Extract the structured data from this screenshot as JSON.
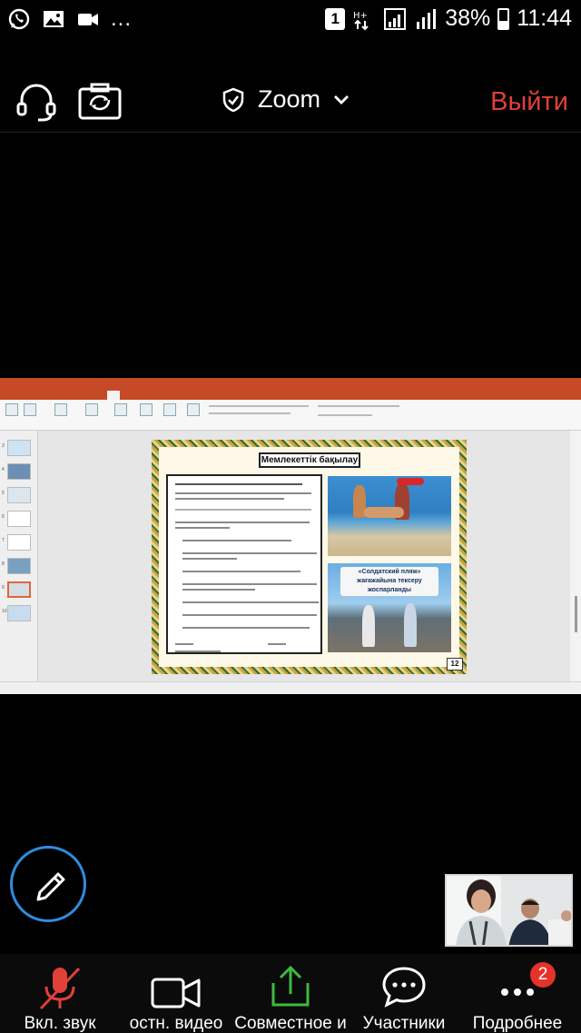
{
  "status_bar": {
    "notifications": [
      "whatsapp-icon",
      "gallery-icon",
      "video-call-icon"
    ],
    "more": "...",
    "sim_badge": "1",
    "battery": "38%",
    "time": "11:44"
  },
  "top_bar": {
    "title": "Zoom",
    "leave_label": "Выйти"
  },
  "shared_screen": {
    "slide_title": "Мемлекеттік бақылау",
    "photo_caption": "«Солдатский пляж» жағажайына тексеру жоспарланды",
    "slide_number": "12",
    "thumbnails": [
      "3",
      "4",
      "5",
      "6",
      "7",
      "8",
      "9",
      "10"
    ]
  },
  "toolbar": {
    "audio_label": "Вкл. звук",
    "video_label": "остн. видео",
    "share_label": "Совместное и",
    "participants_label": "Участники",
    "more_label": "Подробнее",
    "participants_count": "2"
  },
  "colors": {
    "leave": "#e0403a",
    "share_green": "#3dbb3d",
    "mute_red": "#e0403a",
    "fab_blue": "#2f8ce0",
    "badge_red": "#e6332a"
  }
}
